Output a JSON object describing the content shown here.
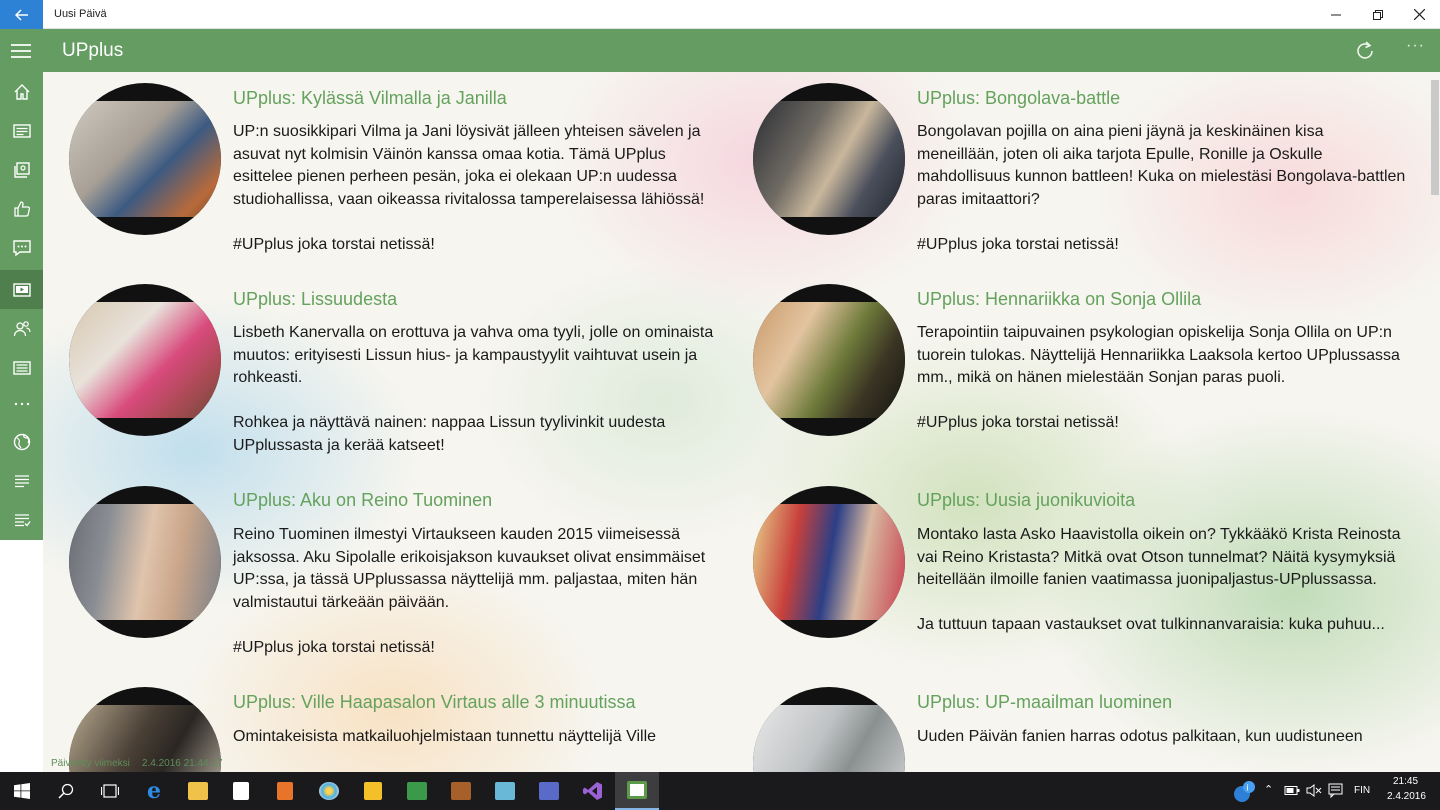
{
  "window": {
    "title": "Uusi Päivä"
  },
  "header": {
    "title": "UPplus"
  },
  "sidebar": {
    "items": [
      {
        "name": "home",
        "label": "Koti"
      },
      {
        "name": "news",
        "label": "Uutiset"
      },
      {
        "name": "gallery",
        "label": "Galleria"
      },
      {
        "name": "likes",
        "label": "Tykkää"
      },
      {
        "name": "comments",
        "label": "Kommentit"
      },
      {
        "name": "upplus",
        "label": "UPplus"
      },
      {
        "name": "characters",
        "label": "Hahmot"
      },
      {
        "name": "articles",
        "label": "Artikkelit"
      },
      {
        "name": "more",
        "label": "Lisää"
      },
      {
        "name": "web",
        "label": "Verkko"
      },
      {
        "name": "list",
        "label": "Lista"
      },
      {
        "name": "feed",
        "label": "Syöte"
      }
    ]
  },
  "articles": [
    {
      "title": "UPplus: Kylässä Vilmalla ja Janilla",
      "body": "UP:n suosikkipari Vilma ja Jani löysivät jälleen yhteisen sävelen ja asuvat nyt kolmisin Väinön kanssa omaa kotia. Tämä UPplus esittelee pienen perheen pesän, joka ei olekaan UP:n uudessa studiohallissa, vaan oikeassa rivitalossa tamperelaisessa lähiössä!\n\n#UPplus joka torstai netissä!"
    },
    {
      "title": "UPplus: Bongolava-battle",
      "body": "Bongolavan pojilla on aina pieni jäynä ja keskinäinen kisa meneillään, joten oli aika tarjota Epulle, Ronille ja Oskulle mahdollisuus kunnon battleen! Kuka on mielestäsi Bongolava-battlen paras imitaattori?\n\n#UPplus joka torstai netissä!"
    },
    {
      "title": "UPplus: Lissuudesta",
      "body": "Lisbeth Kanervalla on erottuva ja vahva oma tyyli, jolle on ominaista muutos: erityisesti Lissun hius- ja kampaustyylit vaihtuvat usein ja rohkeasti.\n\nRohkea ja näyttävä nainen: nappaa Lissun tyylivinkit uudesta UPplussasta ja kerää katseet!"
    },
    {
      "title": "UPplus: Hennariikka on Sonja Ollila",
      "body": "Terapointiin taipuvainen psykologian opiskelija Sonja Ollila on UP:n tuorein tulokas. Näyttelijä Hennariikka Laaksola kertoo UPplussassa mm., mikä on hänen mielestään Sonjan paras puoli.\n\n#UPplus joka torstai netissä!"
    },
    {
      "title": "UPplus: Aku on Reino Tuominen",
      "body": "Reino Tuominen ilmestyi Virtaukseen kauden 2015 viimeisessä jaksossa. Aku Sipolalle erikoisjakson kuvaukset olivat ensimmäiset UP:ssa, ja tässä UPplussassa näyttelijä mm. paljastaa, miten hän valmistautui tärkeään päivään.\n\n#UPplus joka torstai netissä!"
    },
    {
      "title": "UPplus: Uusia juonikuvioita",
      "body": "Montako lasta Asko Haavistolla oikein on? Tykkääkö Krista Reinosta vai Reino Kristasta? Mitkä ovat Otson tunnelmat? Näitä kysymyksiä heitellään ilmoille fanien vaatimassa juonipaljastus-UPplussassa.\n\nJa tuttuun tapaan vastaukset ovat tulkinnanvaraisia: kuka puhuu..."
    },
    {
      "title": "UPplus: Ville Haapasalon Virtaus alle 3 minuutissa",
      "body": "Omintakeisista matkailuohjelmistaan tunnettu näyttelijä Ville"
    },
    {
      "title": "UPplus: UP-maailman luominen",
      "body": "Uuden Päivän fanien harras odotus palkitaan, kun uudistuneen"
    }
  ],
  "status": {
    "label": "Päivitetty viimeksi",
    "timestamp": "2.4.2016 21.44.17"
  },
  "taskbar": {
    "language": "FIN",
    "time": "21:45",
    "date": "2.4.2016"
  },
  "colors": {
    "accent": "#649c61",
    "accent_dark": "#4f7f4c",
    "title_green": "#64a25d",
    "back_blue": "#2e82d6"
  }
}
